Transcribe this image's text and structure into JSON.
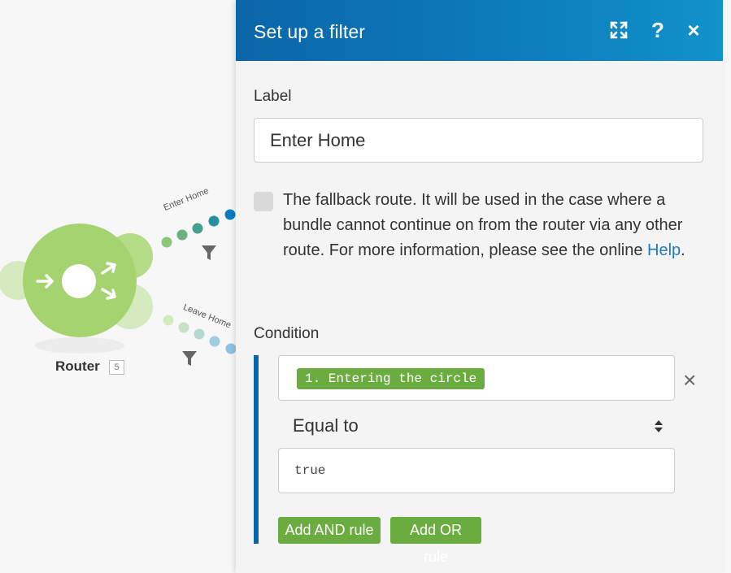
{
  "canvas": {
    "router": {
      "label": "Router",
      "badge": "5"
    },
    "routes": [
      {
        "label": "Enter Home"
      },
      {
        "label": "Leave Home"
      }
    ],
    "colors": {
      "router_green": "#a4d36f",
      "route_blue": "#0b7cbf"
    }
  },
  "panel": {
    "title": "Set up a filter",
    "header_icons": [
      "expand-icon",
      "help-icon",
      "close-icon"
    ],
    "help_glyph": "?",
    "close_glyph": "×",
    "label_field": {
      "label": "Label",
      "value": "Enter Home"
    },
    "fallback": {
      "checked": false,
      "text": "The fallback route. It will be used in the case where a bundle cannot continue on from the router via any other route. For more information, please see the online ",
      "link": "Help",
      "suffix": "."
    },
    "condition": {
      "label": "Condition",
      "operand": "1. Entering the circle",
      "operator": "Equal to",
      "value": "true",
      "remove_glyph": "×",
      "add_and": "Add AND rule",
      "add_or": "Add OR rule"
    },
    "colors": {
      "header": "#0b66a8",
      "pill": "#6aac3f",
      "link": "#1e7bbf"
    }
  }
}
